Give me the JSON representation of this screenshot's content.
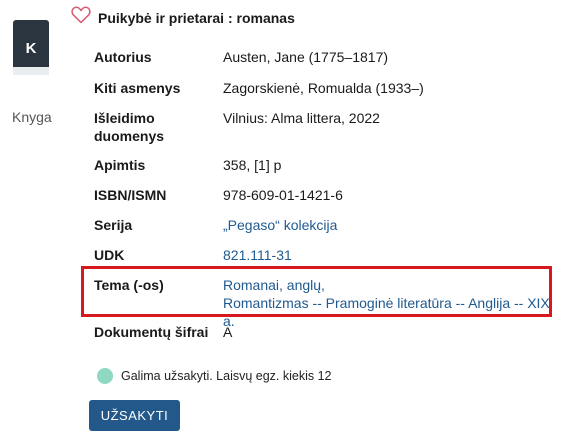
{
  "format": {
    "icon_letter": "K",
    "label": "Knyga"
  },
  "favorite": {
    "icon": "heart-outline-icon"
  },
  "title": "Puikybė ir prietarai : romanas",
  "details": {
    "author": {
      "key": "Autorius",
      "value": "Austen, Jane (1775–1817)"
    },
    "other_persons": {
      "key": "Kiti asmenys",
      "value": "Zagorskienė, Romualda (1933–)"
    },
    "publication": {
      "key_line1": "Išleidimo",
      "key_line2": "duomenys",
      "value": "Vilnius: Alma littera, 2022"
    },
    "extent": {
      "key": "Apimtis",
      "value": "358, [1] p"
    },
    "isbn": {
      "key": "ISBN/ISMN",
      "value": "978-609-01-1421-6"
    },
    "series": {
      "key": "Serija",
      "value": "„Pegaso“ kolekcija"
    },
    "udk": {
      "key": "UDK",
      "value": "821.111-31"
    },
    "subjects": {
      "key": "Tema (-os)",
      "line1": "Romanai, anglų,",
      "line2": "Romantizmas -- Pramoginė literatūra -- Anglija -- XIX a."
    },
    "doc_codes": {
      "key": "Dokumentų šifrai",
      "value": "A"
    }
  },
  "availability": {
    "text": "Galima užsakyti. Laisvų egz. kiekis 12",
    "status_color": "#8fd9c4"
  },
  "order_button": {
    "label": "UŽSAKYTI",
    "color": "#22588a"
  },
  "colors": {
    "link": "#1f5a91",
    "highlight_border": "#d7191f"
  }
}
